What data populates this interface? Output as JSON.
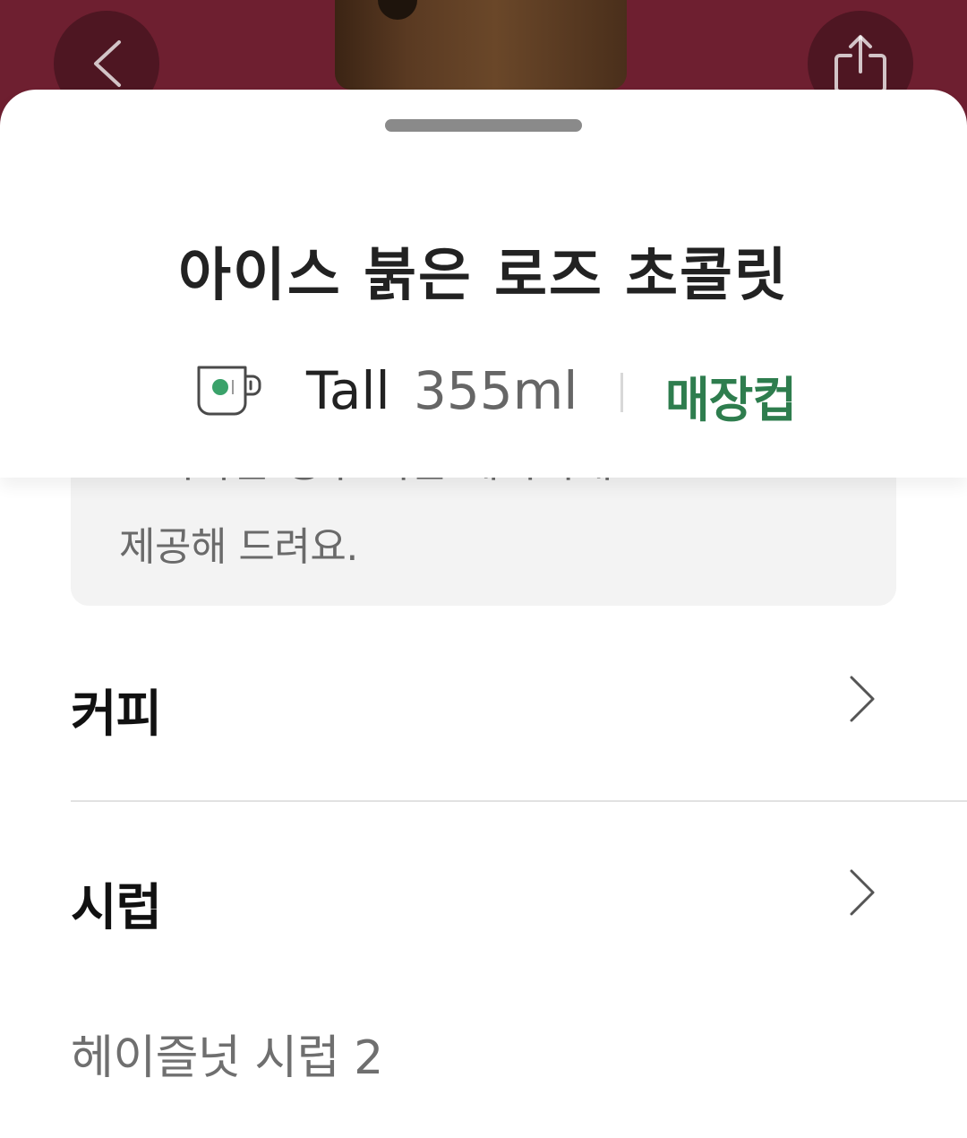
{
  "header": {
    "back_icon": "chevron-left-icon",
    "share_icon": "share-icon"
  },
  "sheet": {
    "title": "아이스 붉은 로즈 초콜릿",
    "size_icon": "mug-icon",
    "size_name": "Tall",
    "size_volume": "355ml",
    "cup_type": "매장컵"
  },
  "description": {
    "partial_line": "오피하는 청구 기는 데시피대로",
    "last_line": "제공해 드려요."
  },
  "options": [
    {
      "label": "커피"
    },
    {
      "label": "시럽"
    }
  ],
  "syrup_value": "헤이즐넛 시럽 2",
  "colors": {
    "hero_background": "#6e1f30",
    "accent_green": "#2e7d4e",
    "cup_dot": "#3aa26a"
  }
}
